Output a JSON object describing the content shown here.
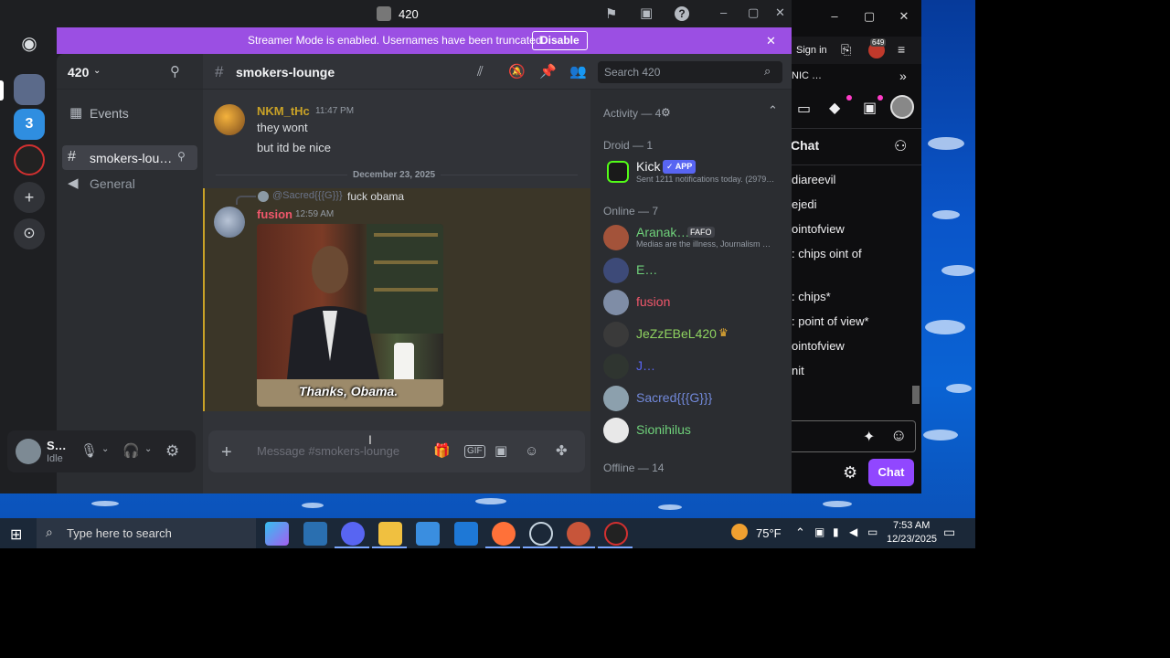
{
  "window": {
    "title": "420",
    "controls": {
      "minimize": "–",
      "maximize": "▢",
      "close": "✕"
    }
  },
  "banner": {
    "text": "Streamer Mode is enabled. Usernames have been truncated.",
    "button": "Disable",
    "close": "✕"
  },
  "server": {
    "name": "420",
    "rail_badge": "3"
  },
  "sidebar": {
    "events": "Events",
    "channels": [
      {
        "name": "smokers-lou…",
        "icon": "hash-icon",
        "selected": true
      },
      {
        "name": "General",
        "icon": "speaker-icon",
        "selected": false
      }
    ]
  },
  "user_panel": {
    "name": "S…",
    "status": "Idle"
  },
  "chat": {
    "channel": "smokers-lounge",
    "search_placeholder": "Search 420",
    "messages": [
      {
        "author": "NKM_tHc",
        "time": "11:47 PM",
        "lines": [
          "they wont",
          "but itd be nice"
        ]
      }
    ],
    "divider": "December 23, 2025",
    "reply": {
      "mention": "@Sacred{{{G}}}",
      "text": "fuck obama",
      "author": "fusion",
      "time": "12:59 AM",
      "image_caption": "Thanks, Obama."
    },
    "input_placeholder": "Message #smokers-lounge"
  },
  "members": {
    "activity": "Activity — 4",
    "droid_header": "Droid — 1",
    "kick": {
      "name": "Kick",
      "badge": "✓ APP",
      "sub": "Sent 1211 notifications today. (2979…"
    },
    "online_header": "Online — 7",
    "online": [
      {
        "name": "Aranak…",
        "tag": "FAFO",
        "sub": "Medias are the illness, Journalism …",
        "color": "#6fd17a"
      },
      {
        "name": "E…",
        "sub": "",
        "color": "#6fd17a"
      },
      {
        "name": "fusion",
        "sub": "",
        "color": "#f0576b"
      },
      {
        "name": "JeZzEBeL420",
        "sub": "",
        "color": "#8fd360"
      },
      {
        "name": "J…",
        "sub": "",
        "color": "#5865f2"
      },
      {
        "name": "Sacred{{{G}}}",
        "sub": "",
        "color": "#7289da"
      },
      {
        "name": "Sionihilus",
        "sub": "",
        "color": "#6fd17a"
      }
    ],
    "offline_header": "Offline — 14"
  },
  "browser": {
    "sign_in": "Sign in",
    "badge": "649",
    "tab": "NIC …",
    "chat_title": "Chat",
    "chat_lines": [
      "diareevil",
      "ejedi",
      "ointofview",
      ": chips oint of",
      ": chips*",
      ": point of view*",
      "ointofview",
      "nit"
    ],
    "chat_button": "Chat"
  },
  "taskbar": {
    "search_placeholder": "Type here to search",
    "weather": "75°F",
    "time": "7:53 AM",
    "date": "12/23/2025"
  },
  "colors": {
    "banner": "#9b4fe3",
    "accent": "#5865f2",
    "twitch": "#9147ff"
  }
}
